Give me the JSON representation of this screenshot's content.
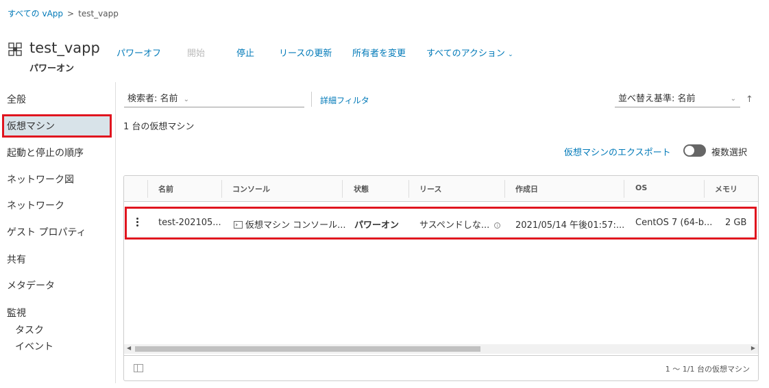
{
  "breadcrumb": {
    "root": "すべての vApp",
    "separator": ">",
    "current": "test_vapp"
  },
  "vapp": {
    "title": "test_vapp",
    "status": "パワーオン"
  },
  "actions": [
    {
      "label": "パワーオフ",
      "enabled": true
    },
    {
      "label": "開始",
      "enabled": false
    },
    {
      "label": "停止",
      "enabled": true
    },
    {
      "label": "リースの更新",
      "enabled": true
    },
    {
      "label": "所有者を変更",
      "enabled": true
    },
    {
      "label": "すべてのアクション",
      "enabled": true
    }
  ],
  "sidebar": {
    "items": [
      {
        "label": "全般"
      },
      {
        "label": "仮想マシン",
        "selected": true
      },
      {
        "label": "起動と停止の順序"
      },
      {
        "label": "ネットワーク図"
      },
      {
        "label": "ネットワーク"
      },
      {
        "label": "ゲスト プロパティ"
      },
      {
        "label": "共有"
      },
      {
        "label": "メタデータ"
      },
      {
        "label": "監視"
      }
    ],
    "monitor_sub": [
      {
        "label": "タスク"
      },
      {
        "label": "イベント"
      }
    ]
  },
  "toolbar": {
    "search_by_label": "検索者: 名前",
    "advanced_filter": "詳細フィルタ",
    "sort_label": "並べ替え基準: 名前",
    "sort_direction_icon": "↑"
  },
  "vm_count_text": "1 台の仮想マシン",
  "export_link": "仮想マシンのエクスポート",
  "multi_select": {
    "label": "複数選択",
    "on": false
  },
  "grid": {
    "columns": [
      "名前",
      "コンソール",
      "状態",
      "リース",
      "作成日",
      "OS",
      "メモリ"
    ],
    "rows": [
      {
        "name": "test-202105...",
        "console": "仮想マシン コンソール...",
        "state": "パワーオン",
        "lease": "サスペンドしな...",
        "created": "2021/05/14 午後01:57:...",
        "os": "CentOS 7 (64-b...",
        "memory": "2 GB"
      }
    ],
    "footer": "1 ～ 1/1 台の仮想マシン"
  },
  "colors": {
    "link": "#0079b8",
    "highlight": "#e0141e",
    "selected_nav": "#d8e3e9"
  }
}
